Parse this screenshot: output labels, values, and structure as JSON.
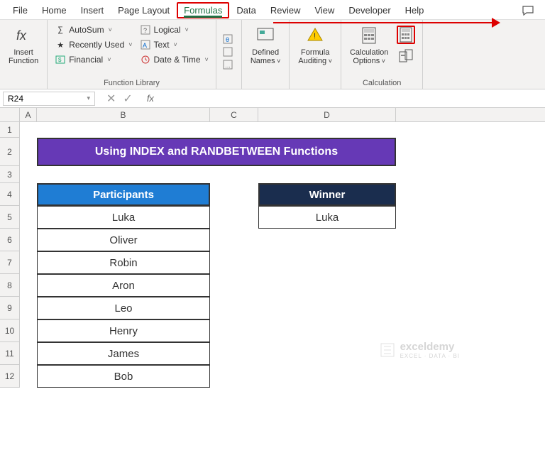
{
  "tabs": [
    "File",
    "Home",
    "Insert",
    "Page Layout",
    "Formulas",
    "Data",
    "Review",
    "View",
    "Developer",
    "Help"
  ],
  "active_tab": "Formulas",
  "ribbon": {
    "insert_fn": "Insert\nFunction",
    "lib": {
      "autosum": "AutoSum",
      "recent": "Recently Used",
      "financial": "Financial",
      "logical": "Logical",
      "text": "Text",
      "datetime": "Date & Time",
      "label": "Function Library"
    },
    "defined": "Defined\nNames",
    "auditing": "Formula\nAuditing",
    "calc_opts": "Calculation\nOptions",
    "calc_label": "Calculation"
  },
  "namebox": "R24",
  "columns": [
    "A",
    "B",
    "C",
    "D"
  ],
  "rows": [
    "1",
    "2",
    "3",
    "4",
    "5",
    "6",
    "7",
    "8",
    "9",
    "10",
    "11",
    "12"
  ],
  "sheet": {
    "title": "Using INDEX and RANDBETWEEN Functions",
    "participants_header": "Participants",
    "winner_header": "Winner",
    "participants": [
      "Luka",
      "Oliver",
      "Robin",
      "Aron",
      "Leo",
      "Henry",
      "James",
      "Bob"
    ],
    "winner": "Luka"
  },
  "watermark": {
    "brand": "exceldemy",
    "tag": "EXCEL · DATA · BI"
  }
}
